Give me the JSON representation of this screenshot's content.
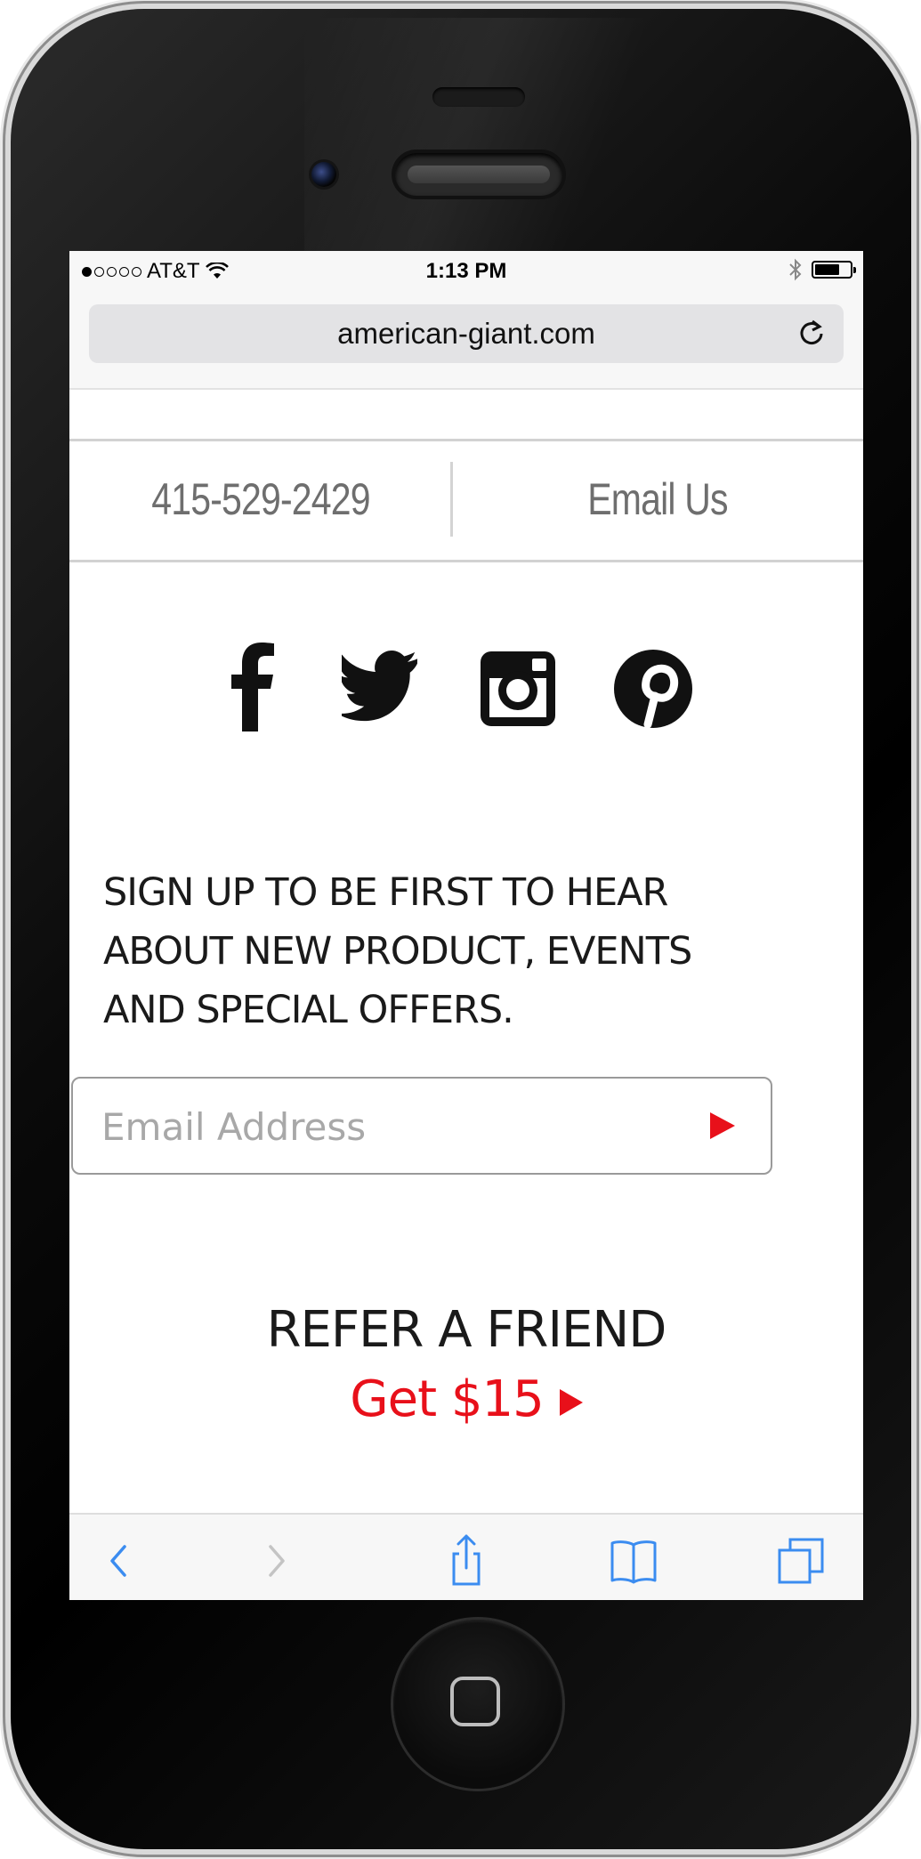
{
  "statusbar": {
    "carrier": "AT&T",
    "time": "1:13 PM",
    "signal_bars_filled": 1,
    "signal_bars_total": 5,
    "battery_level": 0.7
  },
  "browser": {
    "url": "american-giant.com"
  },
  "contact": {
    "phone": "415-529-2429",
    "email_label": "Email Us"
  },
  "social": [
    "facebook-icon",
    "twitter-icon",
    "instagram-icon",
    "pinterest-icon"
  ],
  "signup": {
    "text": "SIGN UP TO BE FIRST TO HEAR\nABOUT NEW PRODUCT, EVENTS\nAND SPECIAL OFFERS.",
    "placeholder": "Email Address"
  },
  "refer": {
    "title": "REFER A FRIEND",
    "link": "Get $15"
  },
  "colors": {
    "accent": "#e8101a",
    "ios_blue": "#3b8cf0",
    "contact_gray": "#6e6e6e"
  },
  "toolbar": [
    "back-icon",
    "forward-icon",
    "share-icon",
    "bookmarks-icon",
    "tabs-icon"
  ]
}
